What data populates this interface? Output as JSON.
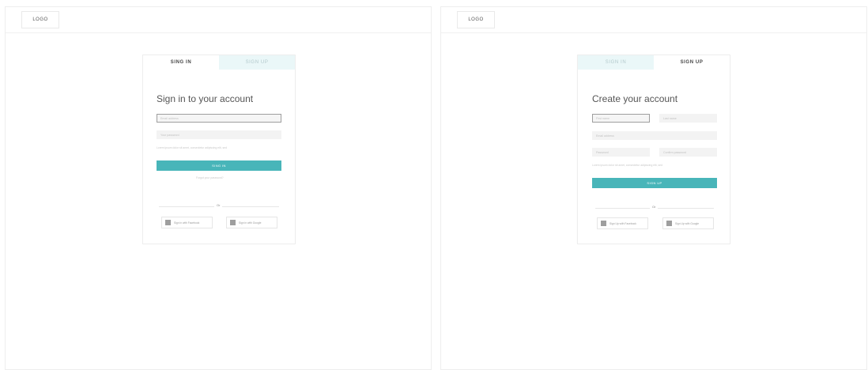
{
  "signin_screen": {
    "logo": "LOGO",
    "tabs": {
      "signin": "SING IN",
      "signup": "SIGN UP"
    },
    "title": "Sign in to your account",
    "email_placeholder": "Email address",
    "password_placeholder": "Your password",
    "terms": "Lorem ipsum dolor sit amet, consectetur adipiscing elit, sed",
    "submit": "SING IN",
    "forgot": "Forgot your password?",
    "or": "Or",
    "facebook": "Sign in with Facebook",
    "google": "Sign in with Google"
  },
  "signup_screen": {
    "logo": "LOGO",
    "tabs": {
      "signin": "SIGN IN",
      "signup": "SIGN UP"
    },
    "title": "Create your account",
    "firstname_placeholder": "First name",
    "lastname_placeholder": "Last name",
    "email_placeholder": "Email address",
    "password_placeholder": "Password",
    "confirm_placeholder": "Confirm password",
    "terms": "Lorem ipsum dolor sit amet, consectetur adipiscing elit, sed",
    "submit": "SIGN UP",
    "or": "Or",
    "facebook": "Sign Up with Facebook",
    "google": "Sign Up with Google"
  },
  "colors": {
    "accent": "#48b5b9",
    "inactive_tab": "#eaf7f8",
    "field_bg": "#f3f3f3"
  }
}
